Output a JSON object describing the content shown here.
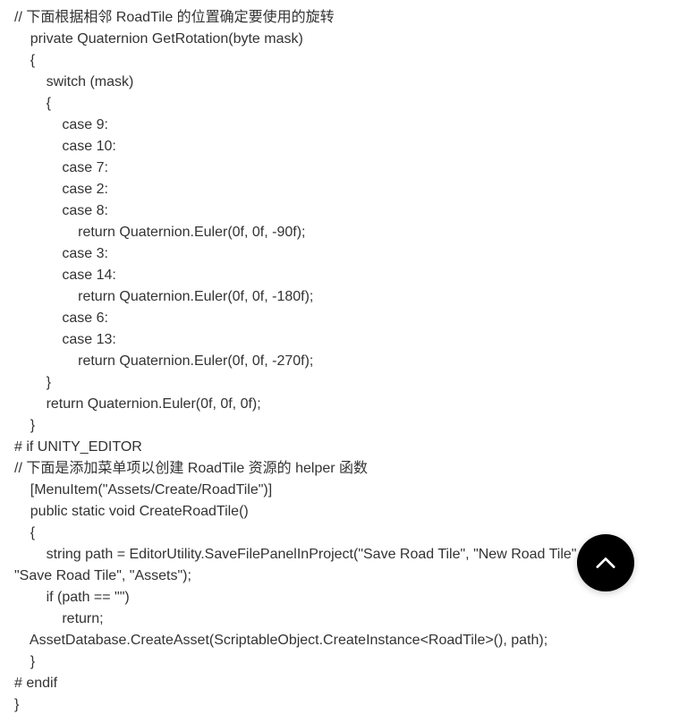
{
  "code": {
    "lines": [
      "// 下面根据相邻 RoadTile 的位置确定要使用的旋转",
      "    private Quaternion GetRotation(byte mask)",
      "    {",
      "        switch (mask)",
      "        {",
      "            case 9:",
      "            case 10:",
      "            case 7:",
      "            case 2:",
      "            case 8:",
      "                return Quaternion.Euler(0f, 0f, -90f);",
      "            case 3:",
      "            case 14:",
      "                return Quaternion.Euler(0f, 0f, -180f);",
      "            case 6:",
      "            case 13:",
      "                return Quaternion.Euler(0f, 0f, -270f);",
      "        }",
      "        return Quaternion.Euler(0f, 0f, 0f);",
      "    }",
      "# if UNITY_EDITOR",
      "// 下面是添加菜单项以创建 RoadTile 资源的 helper 函数",
      "    [MenuItem(\"Assets/Create/RoadTile\")]",
      "    public static void CreateRoadTile()",
      "    {",
      "        string path = EditorUtility.SaveFilePanelInProject(\"Save Road Tile\", \"New Road Tile\", \"Asset\", \"Save Road Tile\", \"Assets\");",
      "        if (path == \"\")",
      "            return;",
      "    AssetDatabase.CreateAsset(ScriptableObject.CreateInstance<RoadTile>(), path);",
      "    }",
      "# endif",
      "}"
    ]
  }
}
